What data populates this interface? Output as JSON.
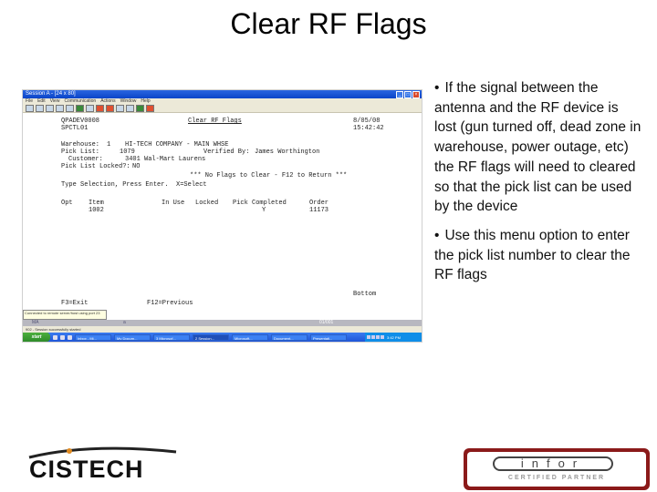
{
  "slide": {
    "title": "Clear RF Flags",
    "bullets": [
      "If the signal between the antenna and the RF device is lost (gun turned off, dead zone in warehouse, power outage, etc) the RF flags will need to cleared so that the pick list can be used by the device",
      "Use this menu option to enter the pick list number to clear the RF flags"
    ],
    "bullet_glyph": "•"
  },
  "screenshot": {
    "window_title": "Session A - [24 x 80]",
    "window_buttons": [
      "_",
      "□",
      "×"
    ],
    "menu": [
      "File",
      "Edit",
      "View",
      "Communication",
      "Actions",
      "Window",
      "Help"
    ],
    "terminal": {
      "program": "QPADEV0008",
      "screen_id": "SPCTL01",
      "screen_title": "Clear RF Flags",
      "date": "8/05/08",
      "time": "15:42:42",
      "warehouse_label": "Warehouse:",
      "warehouse_value": "1",
      "company": "HI-TECH COMPANY - MAIN WHSE",
      "pick_list_label": "Pick List:",
      "pick_list_value": "1079",
      "verified_label": "Verified By:",
      "verified_value": "James Worthington",
      "customer_label": "Customer:",
      "customer_value": "3401 Wal-Mart Laurens",
      "locked_label": "Pick List Locked?:",
      "locked_value": "NO",
      "message": "*** No Flags to Clear - F12 to Return ***",
      "instruction": "Type Selection, Press Enter.  X=Select",
      "columns": [
        "Opt",
        "Item",
        "In Use",
        "Locked",
        "Pick Completed",
        "Order"
      ],
      "rows": [
        {
          "opt": "",
          "item": "1002",
          "in_use": "",
          "locked": "",
          "pick_completed": "Y",
          "order": "11173"
        }
      ],
      "bottom_marker": "Bottom",
      "fkeys": [
        "F3=Exit",
        "F12=Previous"
      ]
    },
    "tooltip": "Connected to remote server/host using port 23",
    "status_left": "MA",
    "status_mid": "a",
    "status_pos": "01/001",
    "infobar": "902 - Session successfully started",
    "taskbar": {
      "start_label": "start",
      "tasks": [
        "Inbox - Mi...",
        "My Docum...",
        "3 Microsof...",
        "2 Session...",
        "Microsoft...",
        "Document...",
        "Presentati..."
      ],
      "clock": "3:42 PM"
    }
  },
  "logos": {
    "left": "CISTECH",
    "right_main": "infor",
    "right_sub": "CERTIFIED PARTNER"
  }
}
